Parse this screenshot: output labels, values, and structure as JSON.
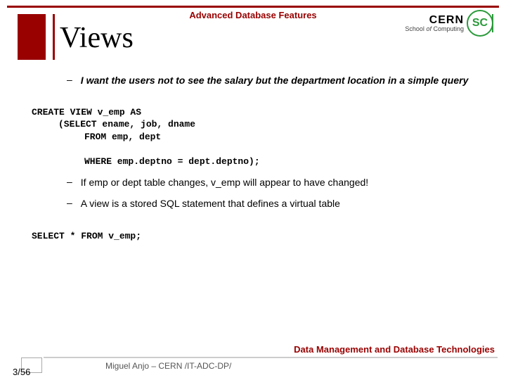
{
  "header": {
    "course": "Advanced Database Features",
    "logo_top": "CERN",
    "logo_bottom_1": "School",
    "logo_bottom_2": "of",
    "logo_bottom_3": "Computing",
    "logo_mono": "SC"
  },
  "title": "Views",
  "bullets": {
    "b1": "I want the users not to see the salary but the department location in a simple query",
    "b2": "If emp or dept table changes, v_emp will appear to have changed!",
    "b3": "A view is a stored SQL statement that defines a virtual table"
  },
  "code": {
    "l1": "CREATE VIEW v_emp AS",
    "l2": "(SELECT ename, job, dname",
    "l3": "FROM emp, dept",
    "l4": "WHERE emp.deptno = dept.deptno);",
    "l5": "SELECT * FROM v_emp;"
  },
  "footer": {
    "page": "3/56",
    "author": "Miguel Anjo – CERN /IT-ADC-DP/",
    "track": "Data Management and Database Technologies"
  }
}
